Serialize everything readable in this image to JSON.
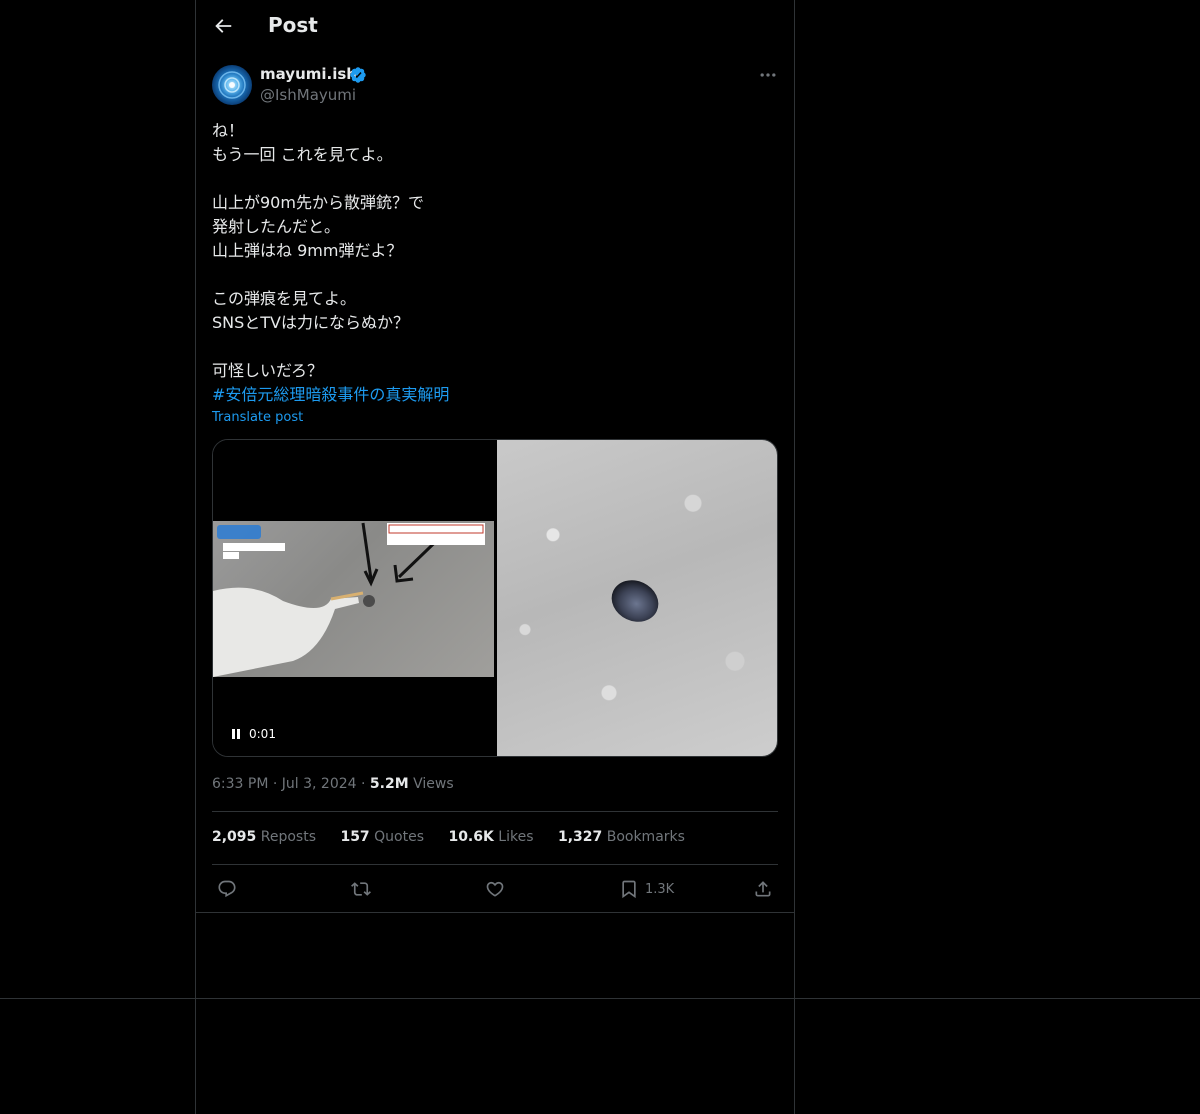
{
  "header": {
    "title": "Post"
  },
  "author": {
    "name": "mayumi.ish",
    "handle": "@IshMayumi"
  },
  "post": {
    "lines": [
      "ね！",
      "もう一回 これを見てよ。",
      "",
      "山上が90m先から散弾銃？で",
      "発射したんだと。",
      "山上弾はね 9mm弾だよ？",
      "",
      "この弾痕を見てよ。",
      "SNSとTVは力にならぬか？",
      "",
      "可怪しいだろ？"
    ],
    "hashtag": "#安倍元総理暗殺事件の真実解明",
    "translate_label": "Translate post"
  },
  "video": {
    "time": "0:01",
    "state": "playing"
  },
  "meta": {
    "time": "6:33 PM",
    "date": "Jul 3, 2024",
    "views_count": "5.2M",
    "views_label": "Views"
  },
  "stats": {
    "reposts_count": "2,095",
    "reposts_label": "Reposts",
    "quotes_count": "157",
    "quotes_label": "Quotes",
    "likes_count": "10.6K",
    "likes_label": "Likes",
    "bookmarks_count": "1,327",
    "bookmarks_label": "Bookmarks"
  },
  "actions": {
    "bookmark_count": "1.3K"
  },
  "colors": {
    "background": "#000000",
    "text": "#e7e9ea",
    "muted": "#71767b",
    "link": "#1d9bf0",
    "border": "#2f3336",
    "verified": "#1d9bf0"
  }
}
